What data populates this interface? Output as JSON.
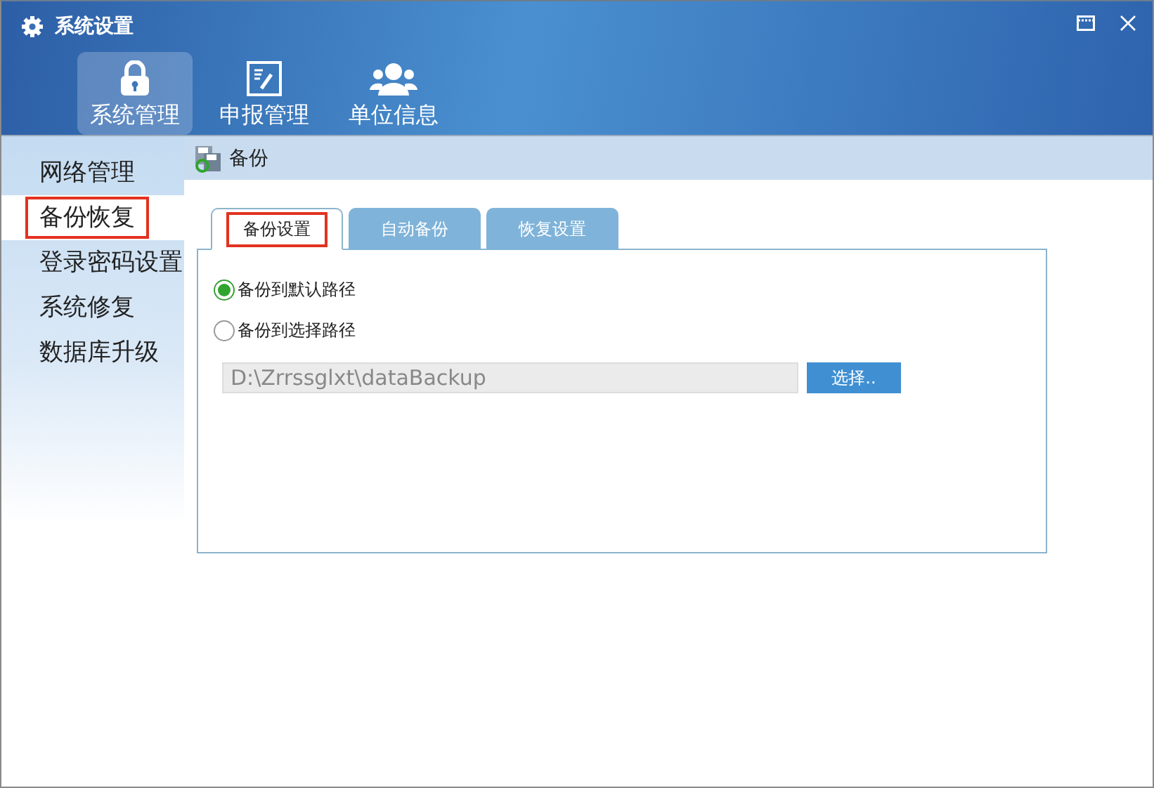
{
  "window": {
    "title": "系统设置"
  },
  "top_nav": [
    {
      "label": "系统管理",
      "selected": true
    },
    {
      "label": "申报管理",
      "selected": false
    },
    {
      "label": "单位信息",
      "selected": false
    }
  ],
  "sidebar": {
    "items": [
      {
        "label": "网络管理",
        "selected": false,
        "highlighted": false
      },
      {
        "label": "备份恢复",
        "selected": true,
        "highlighted": true
      },
      {
        "label": "登录密码设置",
        "selected": false,
        "highlighted": false
      },
      {
        "label": "系统修复",
        "selected": false,
        "highlighted": false
      },
      {
        "label": "数据库升级",
        "selected": false,
        "highlighted": false
      }
    ]
  },
  "content": {
    "header": "备份",
    "tabs": [
      {
        "label": "备份设置",
        "selected": true,
        "highlighted": true
      },
      {
        "label": "自动备份",
        "selected": false,
        "highlighted": false
      },
      {
        "label": "恢复设置",
        "selected": false,
        "highlighted": false
      }
    ],
    "options": [
      {
        "label": "备份到默认路径",
        "selected": true
      },
      {
        "label": "备份到选择路径",
        "selected": false
      }
    ],
    "path_field": {
      "value": "D:\\Zrrssglxt\\dataBackup",
      "disabled": true
    },
    "browse_button": "选择.."
  }
}
